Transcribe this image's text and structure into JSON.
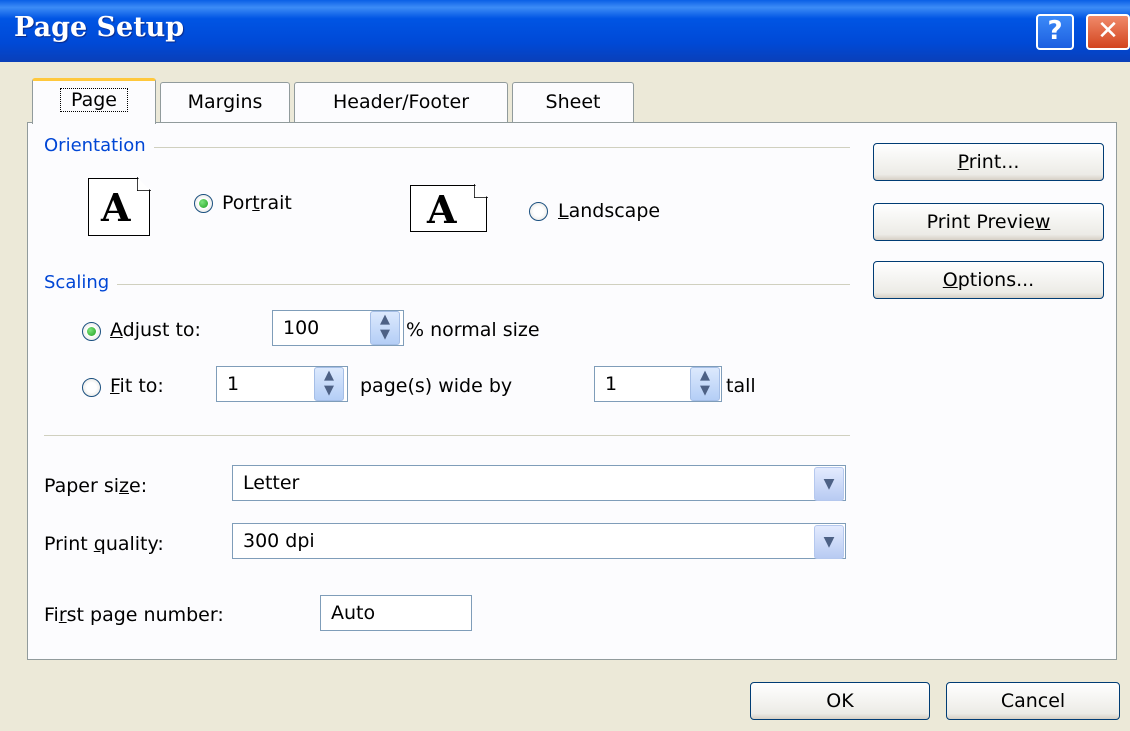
{
  "window": {
    "title": "Page Setup",
    "help_glyph": "?",
    "close_glyph": "✕"
  },
  "tabs": [
    {
      "label": "Page",
      "active": true
    },
    {
      "label": "Margins",
      "active": false
    },
    {
      "label": "Header/Footer",
      "active": false
    },
    {
      "label": "Sheet",
      "active": false
    }
  ],
  "orientation": {
    "group_label": "Orientation",
    "portrait": {
      "pre": "Por",
      "key": "t",
      "post": "rait",
      "selected": true
    },
    "landscape": {
      "pre": "",
      "key": "L",
      "post": "andscape",
      "selected": false
    },
    "icon_glyph": "A"
  },
  "scaling": {
    "group_label": "Scaling",
    "adjust": {
      "pre": "",
      "key": "A",
      "post": "djust to:",
      "value": "100",
      "suffix": "% normal size",
      "selected": true
    },
    "fit": {
      "pre": "",
      "key": "F",
      "post": "it to:",
      "wide_value": "1",
      "wide_label": "page(s) wide by",
      "tall_value": "1",
      "tall_label": "tall",
      "selected": false
    }
  },
  "paper_size": {
    "pre": "Paper si",
    "key": "z",
    "post": "e:",
    "value": "Letter"
  },
  "print_quality": {
    "pre": "Print ",
    "key": "q",
    "post": "uality:",
    "value": "300 dpi"
  },
  "first_page": {
    "pre": "Fi",
    "key": "r",
    "post": "st page number:",
    "value": "Auto"
  },
  "side_buttons": {
    "print": {
      "pre": "",
      "key": "P",
      "post": "rint..."
    },
    "preview": {
      "pre": "Print Previe",
      "key": "w",
      "post": ""
    },
    "options": {
      "pre": "",
      "key": "O",
      "post": "ptions..."
    }
  },
  "footer": {
    "ok_label": "OK",
    "cancel_label": "Cancel"
  },
  "colors": {
    "titlebar": "#0055E4",
    "face": "#ECE9D8",
    "group_label": "#0046D5",
    "active_tab_accent": "#FFC83C",
    "radio_dot": "#21A121"
  }
}
